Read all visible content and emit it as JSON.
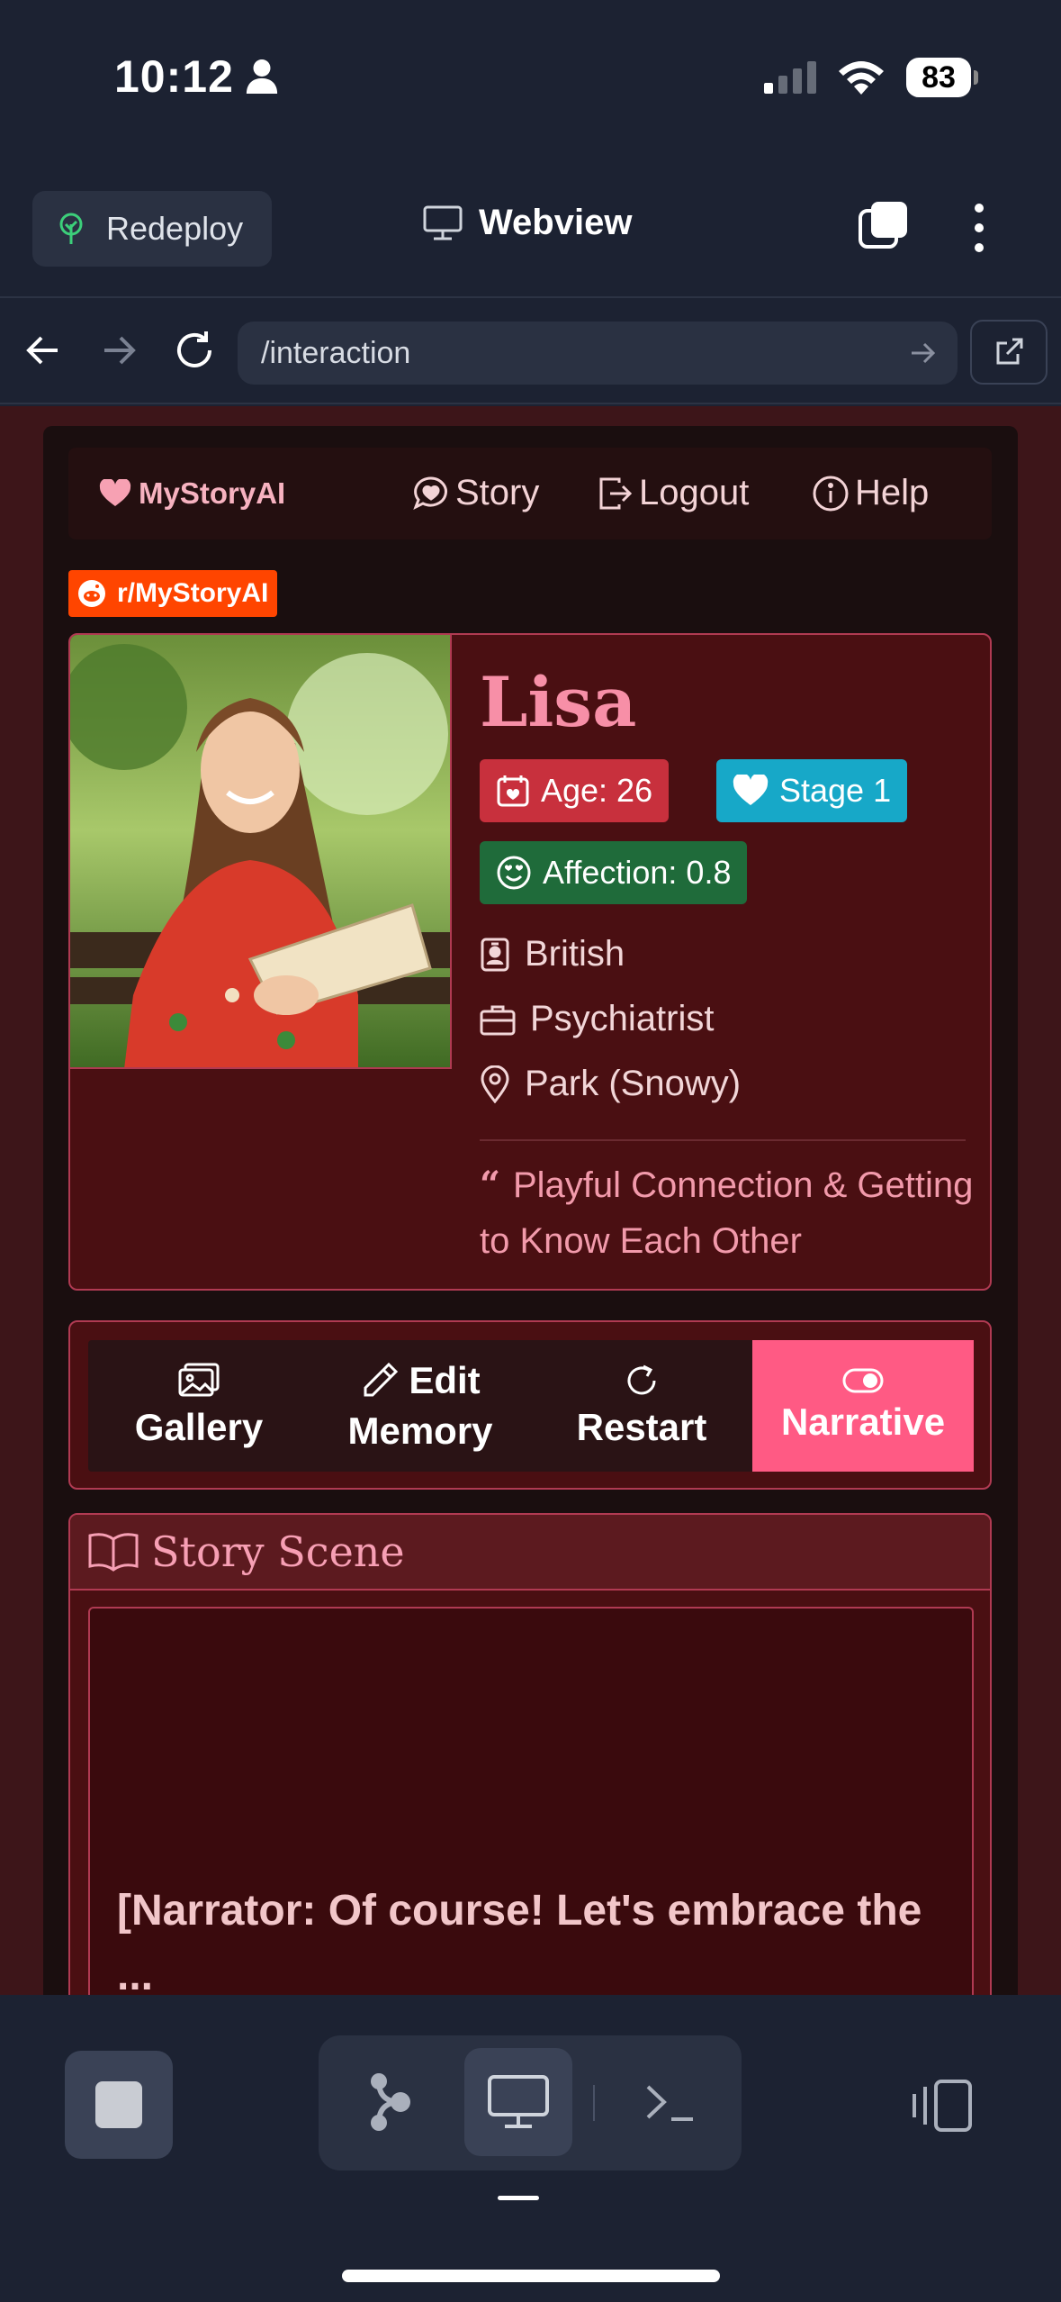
{
  "status": {
    "time": "10:12",
    "battery": "83"
  },
  "appbar": {
    "redeploy_label": "Redeploy",
    "title": "Webview"
  },
  "urlbar": {
    "url": "/interaction"
  },
  "site": {
    "brand": "MyStoryAI",
    "nav": {
      "story": "Story",
      "logout": "Logout",
      "help": "Help"
    },
    "reddit_badge": "r/MyStoryAI"
  },
  "character": {
    "name": "Lisa",
    "age_badge": "Age: 26",
    "stage_badge": "Stage 1",
    "affection_badge": "Affection: 0.8",
    "nationality": "British",
    "occupation": "Psychiatrist",
    "location": "Park (Snowy)",
    "quote": "Playful Connection & Getting to Know Each Other"
  },
  "actions": {
    "gallery": "Gallery",
    "edit_top": "Edit",
    "edit_bottom": "Memory",
    "restart": "Restart",
    "narrative": "Narrative"
  },
  "scene": {
    "title": "Story Scene",
    "text": "[Narrator: Of course! Let's embrace the ..."
  },
  "colors": {
    "accent_pink": "#ff5a84",
    "age_badge": "#c8303d",
    "stage_badge": "#17a8c8",
    "affection_badge": "#1f6b3a",
    "reddit": "#ff4500"
  }
}
